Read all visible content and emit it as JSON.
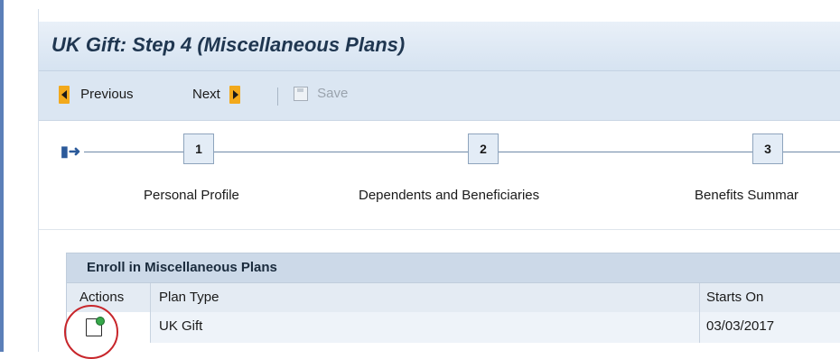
{
  "window": {
    "title": "UK Gift: Step 4  (Miscellaneous Plans)"
  },
  "toolbar": {
    "previous_label": "Previous",
    "next_label": "Next",
    "save_label": "Save"
  },
  "roadmap": {
    "steps": [
      {
        "number": "1",
        "label": "Personal Profile"
      },
      {
        "number": "2",
        "label": "Dependents and Beneficiaries"
      },
      {
        "number": "3",
        "label": "Benefits Summar"
      }
    ]
  },
  "table": {
    "title": "Enroll in Miscellaneous Plans",
    "columns": [
      "Actions",
      "Plan Type",
      "Starts On"
    ],
    "rows": [
      {
        "plan_type": "UK Gift",
        "starts_on": "03/03/2017"
      }
    ]
  },
  "colors": {
    "accent": "#f2a91c",
    "highlight_circle": "#c8262b",
    "header_bg": "#ccd9e8"
  },
  "icons": [
    "previous-arrow-icon",
    "next-arrow-icon",
    "save-icon",
    "roadmap-start-icon",
    "edit-plan-icon"
  ]
}
